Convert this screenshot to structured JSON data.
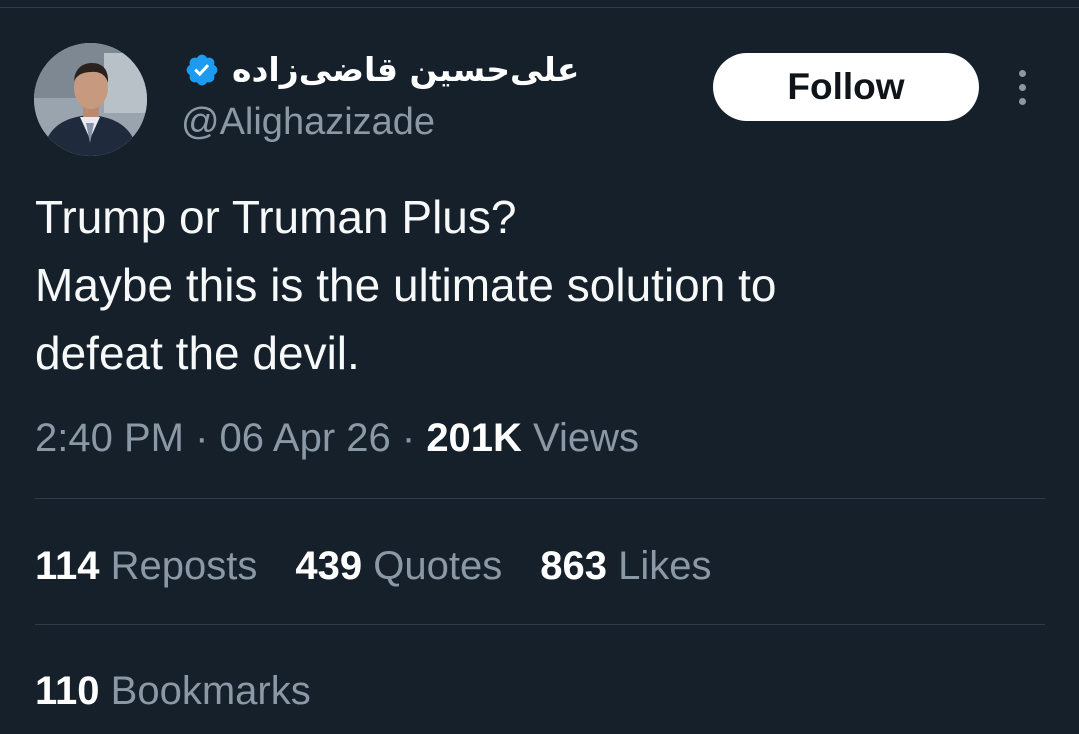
{
  "header": {
    "display_name": "علی‌حسین قاضی‌زاده",
    "handle": "@Alighazizade",
    "follow_label": "Follow"
  },
  "tweet": {
    "lines": [
      "Trump or Truman Plus?",
      "Maybe this is the ultimate solution to",
      "defeat the devil."
    ]
  },
  "meta": {
    "time": "2:40 PM",
    "sep1": " · ",
    "date": "06 Apr 26",
    "sep2": " · ",
    "views_count": "201K",
    "views_label": " Views"
  },
  "stats": {
    "reposts": {
      "count": "114",
      "label": " Reposts"
    },
    "quotes": {
      "count": "439",
      "label": " Quotes"
    },
    "likes": {
      "count": "863",
      "label": " Likes"
    },
    "bookmarks": {
      "count": "110",
      "label": " Bookmarks"
    }
  },
  "colors": {
    "background": "#15202b",
    "text_secondary": "#8b98a5",
    "verified": "#1d9bf0",
    "divider": "#2f3b47"
  },
  "icons": {
    "verified": "verified-badge-icon",
    "more": "more-options-icon"
  }
}
